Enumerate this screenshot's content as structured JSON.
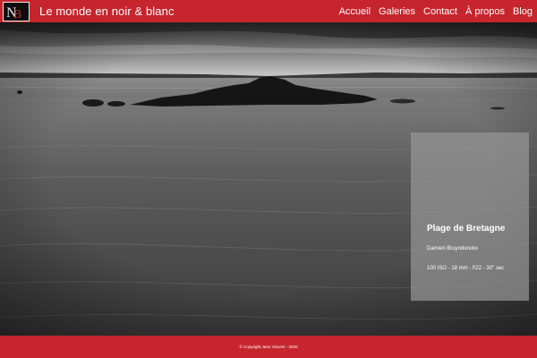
{
  "header": {
    "site_title": "Le monde en noir & blanc",
    "logo_icon": "monogram-logo-icon",
    "nav": [
      {
        "label": "Accueil"
      },
      {
        "label": "Galeries"
      },
      {
        "label": "Contact"
      },
      {
        "label": "À propos"
      },
      {
        "label": "Blog"
      }
    ]
  },
  "hero": {
    "photo_title": "Plage de Bretagne",
    "author": "Damien Bruyndonckx",
    "exif": "100 ISO - 18 mm - f/22 - 30\" sec"
  },
  "footer": {
    "copyright": "© Copyright Jean Vincent - 2020"
  },
  "colors": {
    "accent": "#c7252d",
    "card_bg": "#969696"
  }
}
